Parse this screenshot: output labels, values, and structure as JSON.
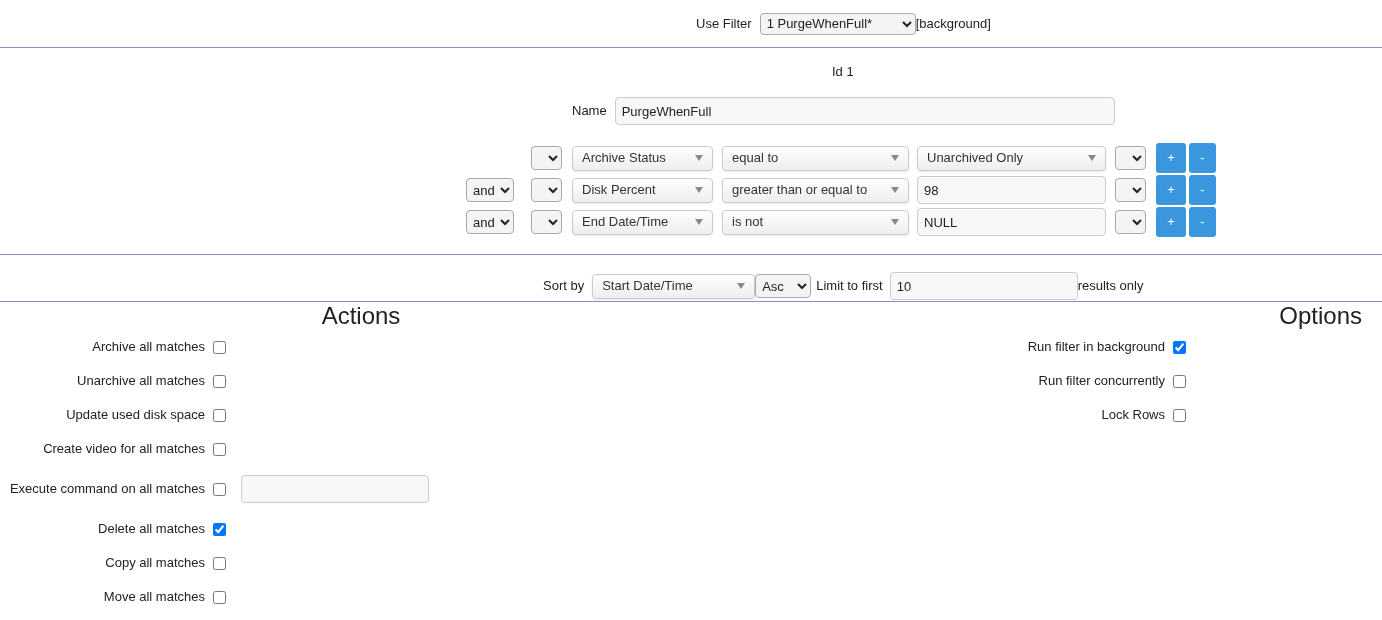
{
  "filter_bar": {
    "label": "Use Filter",
    "selected_filter": "1 PurgeWhenFull*",
    "suffix": "[background]"
  },
  "id_label": "Id 1",
  "name_field": {
    "label": "Name",
    "value": "PurgeWhenFull"
  },
  "terms": [
    {
      "field": "Archive Status",
      "operator": "equal to",
      "kind": "select",
      "value": "Unarchived Only",
      "add_button": "+",
      "remove_button": "-"
    },
    {
      "conjunction": "and",
      "field": "Disk Percent",
      "operator": "greater than or equal to",
      "kind": "input",
      "value": "98",
      "add_button": "+",
      "remove_button": "-"
    },
    {
      "conjunction": "and",
      "field": "End Date/Time",
      "operator": "is not",
      "kind": "input",
      "value": "NULL",
      "add_button": "+",
      "remove_button": "-"
    }
  ],
  "sort": {
    "label": "Sort by",
    "field": "Start Date/Time",
    "direction": "Asc",
    "limit_label": "Limit to first",
    "limit": "10",
    "limit_suffix": "results only"
  },
  "actions": {
    "title": "Actions",
    "items": [
      {
        "kind": "checkbox",
        "label": "Archive all matches",
        "checked": false
      },
      {
        "kind": "checkbox",
        "label": "Unarchive all matches",
        "checked": false
      },
      {
        "kind": "checkbox",
        "label": "Update used disk space",
        "checked": false
      },
      {
        "kind": "checkbox",
        "label": "Create video for all matches",
        "checked": false
      },
      {
        "kind": "command",
        "label": "Execute command on all matches",
        "checked": false
      },
      {
        "kind": "checkbox",
        "label": "Delete all matches",
        "checked": true
      },
      {
        "kind": "checkbox",
        "label": "Copy all matches",
        "checked": false
      },
      {
        "kind": "checkbox",
        "label": "Move all matches",
        "checked": false
      }
    ]
  },
  "options": {
    "title": "Options",
    "items": [
      {
        "label": "Run filter in background",
        "checked": true
      },
      {
        "label": "Run filter concurrently",
        "checked": false
      },
      {
        "label": "Lock Rows",
        "checked": false
      }
    ]
  }
}
